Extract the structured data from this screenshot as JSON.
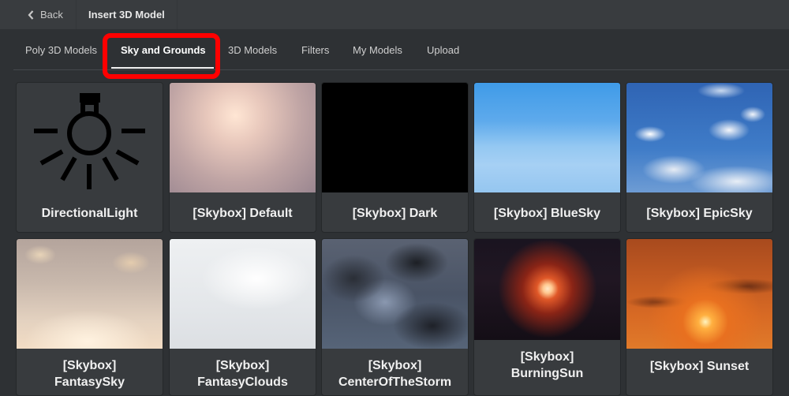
{
  "header": {
    "back_label": "Back",
    "title": "Insert 3D Model"
  },
  "tabs": [
    {
      "label": "Poly 3D Models",
      "active": false
    },
    {
      "label": "Sky and Grounds",
      "active": true
    },
    {
      "label": "3D Models",
      "active": false
    },
    {
      "label": "Filters",
      "active": false
    },
    {
      "label": "My Models",
      "active": false
    },
    {
      "label": "Upload",
      "active": false
    }
  ],
  "highlight_color": "#ff0000",
  "items": [
    {
      "label": "DirectionalLight",
      "thumbnail": "lightbulb-icon"
    },
    {
      "label": "[Skybox] Default",
      "thumbnail": "skybox-default"
    },
    {
      "label": "[Skybox] Dark",
      "thumbnail": "skybox-dark"
    },
    {
      "label": "[Skybox] BlueSky",
      "thumbnail": "skybox-bluesky"
    },
    {
      "label": "[Skybox] EpicSky",
      "thumbnail": "skybox-epicsky"
    },
    {
      "label": "[Skybox] FantasySky",
      "thumbnail": "skybox-fantasysky"
    },
    {
      "label": "[Skybox] FantasyClouds",
      "thumbnail": "skybox-fantasyclouds"
    },
    {
      "label": "[Skybox] CenterOfTheStorm",
      "thumbnail": "skybox-centerofthestorm"
    },
    {
      "label": "[Skybox] BurningSun",
      "thumbnail": "skybox-burningsun"
    },
    {
      "label": "[Skybox] Sunset",
      "thumbnail": "skybox-sunset"
    }
  ]
}
